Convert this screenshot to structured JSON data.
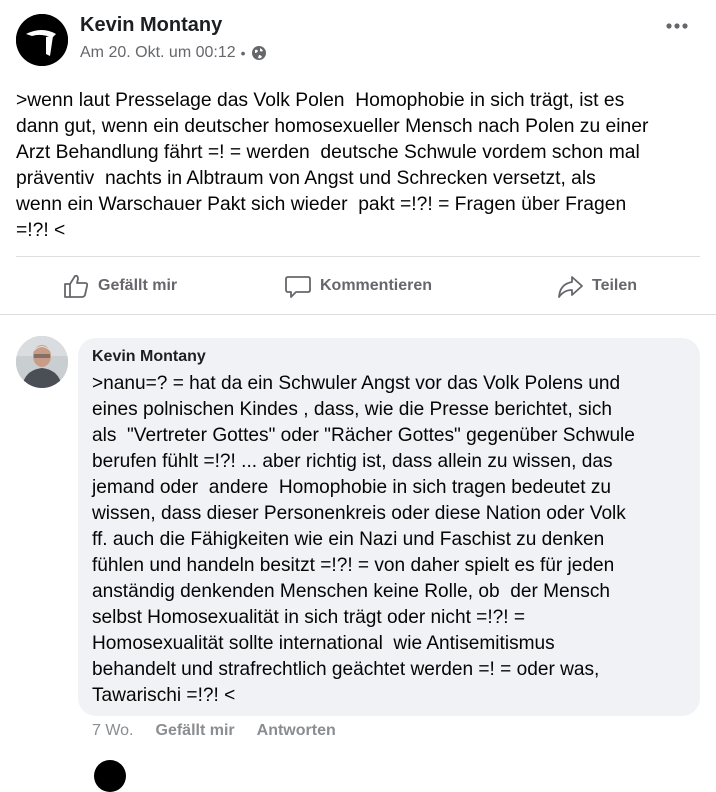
{
  "post": {
    "author": "Kevin Montany",
    "timestamp": "Am 20. Okt. um 00:12",
    "separator": "•",
    "privacy_icon": "globe-icon",
    "more_icon": "more-horizontal-icon",
    "text": ">wenn laut Presselage das Volk Polen  Homophobie in sich trägt, ist es\ndann gut, wenn ein deutscher homosexueller Mensch nach Polen zu einer\nArzt Behandlung fährt =! = werden  deutsche Schwule vordem schon mal\npräventiv  nachts in Albtraum von Angst und Schrecken versetzt, als\nwenn ein Warschauer Pakt sich wieder  pakt =!?! = Fragen über Fragen\n=!?! <"
  },
  "actions": {
    "like_label": "Gefällt mir",
    "comment_label": "Kommentieren",
    "share_label": "Teilen"
  },
  "comment": {
    "author": "Kevin Montany",
    "text": ">nanu=? = hat da ein Schwuler Angst vor das Volk Polens und\neines polnischen Kindes , dass, wie die Presse berichtet, sich\nals  \"Vertreter Gottes\" oder \"Rächer Gottes\" gegenüber Schwule\nberufen fühlt =!?! ... aber richtig ist, dass allein zu wissen, das\njemand oder  andere  Homophobie in sich tragen bedeutet zu\nwissen, dass dieser Personenkreis oder diese Nation oder Volk\nff. auch die Fähigkeiten wie ein Nazi und Faschist zu denken\nfühlen und handeln besitzt =!?! = von daher spielt es für jeden\nanständig denkenden Menschen keine Rolle, ob  der Mensch\nselbst Homosexualität in sich trägt oder nicht =!?! =\nHomosexualität sollte international  wie Antisemitismus\nbehandelt und strafrechtlich geächtet werden =! = oder was,\nTawarischi =!?! <",
    "age": "7 Wo.",
    "like_label": "Gefällt mir",
    "reply_label": "Antworten"
  }
}
